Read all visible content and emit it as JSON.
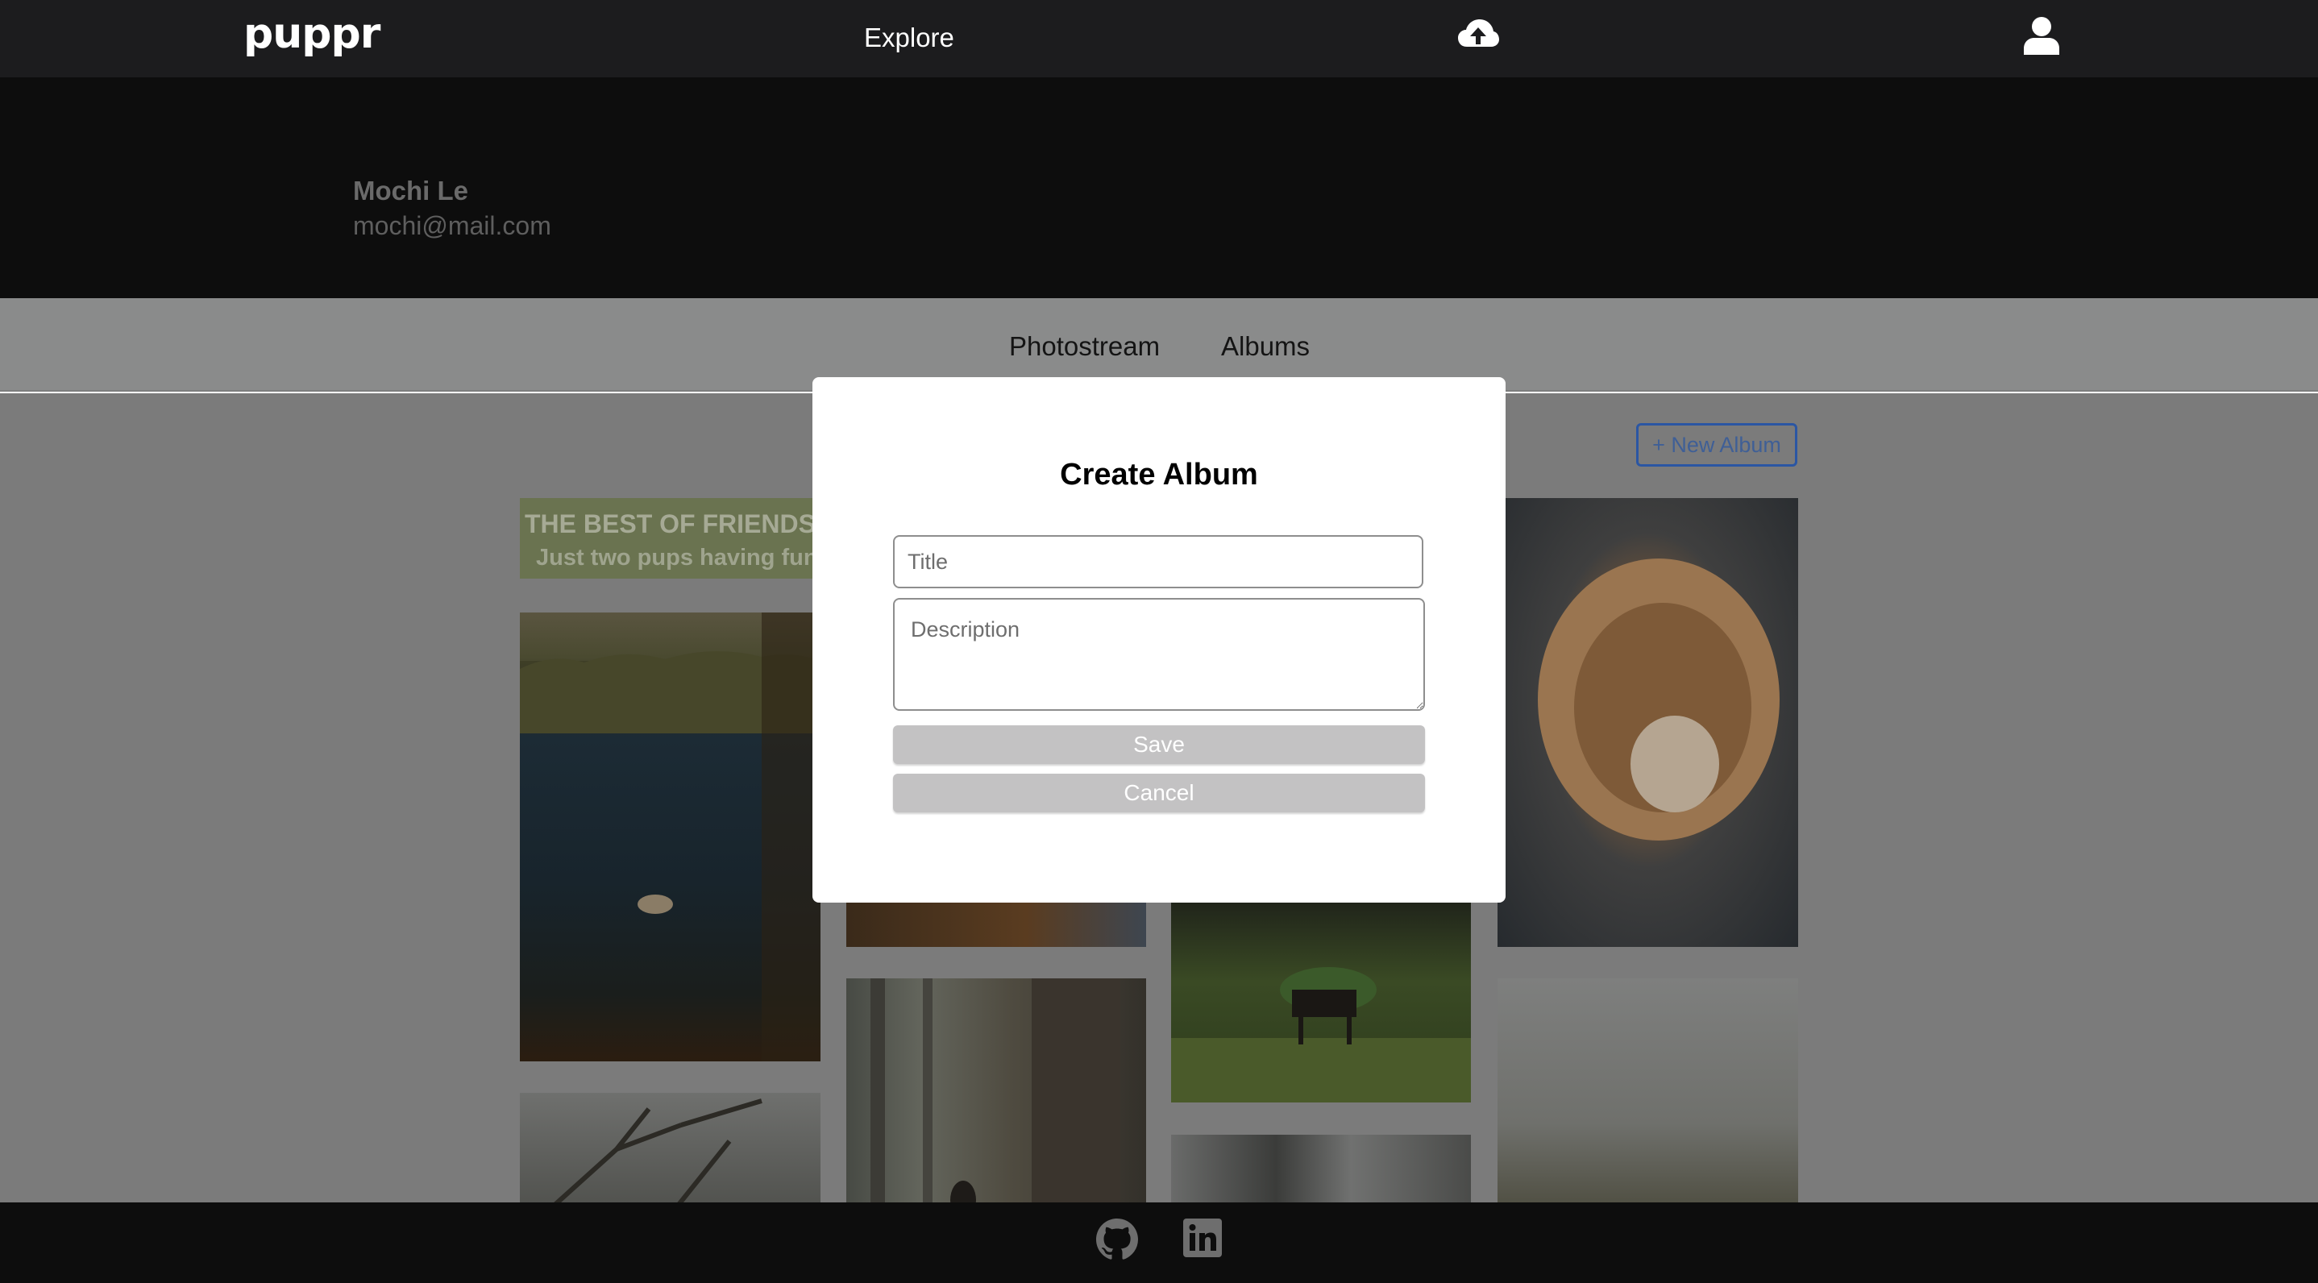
{
  "nav": {
    "logo": "puppr",
    "explore_label": "Explore",
    "upload_icon": "cloud-upload-icon",
    "profile_icon": "user-icon"
  },
  "profile": {
    "name": "Mochi Le",
    "email": "mochi@mail.com"
  },
  "tabs": [
    {
      "label": "Photostream"
    },
    {
      "label": "Albums"
    }
  ],
  "albums_page": {
    "new_album_label": "+ New Album",
    "album_card": {
      "title": "THE BEST OF FRIENDS",
      "subtitle": "Just two pups having fun"
    }
  },
  "modal": {
    "title": "Create Album",
    "title_placeholder": "Title",
    "description_placeholder": "Description",
    "save_label": "Save",
    "cancel_label": "Cancel"
  },
  "footer": {
    "icons": [
      "github-icon",
      "linkedin-icon"
    ]
  },
  "colors": {
    "nav_bg": "#1c1c1e",
    "banner_bg": "#0d0d0d",
    "modal_button": "#c3c2c3",
    "new_album_border": "#2b56a3"
  }
}
